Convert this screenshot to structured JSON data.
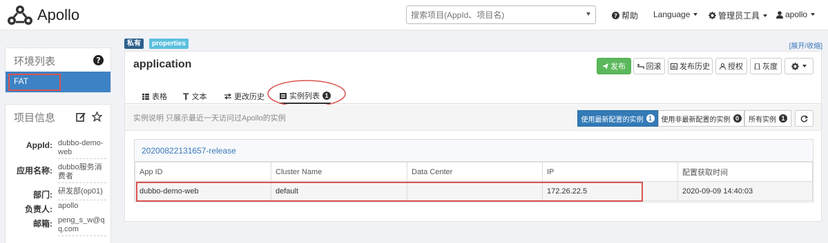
{
  "brand": {
    "name": "Apollo"
  },
  "navbar": {
    "search_placeholder": "搜索项目(AppId、项目名)",
    "help": "帮助",
    "language": "Language",
    "admin_tools": "管理员工具",
    "user": "apollo"
  },
  "sidebar": {
    "env_title": "环境列表",
    "envs": [
      "FAT"
    ],
    "project_title": "项目信息",
    "info": [
      {
        "key": "AppId:",
        "value": "dubbo-demo-web"
      },
      {
        "key": "应用名称:",
        "value": "dubbo服务消费者"
      },
      {
        "key": "部门:",
        "value": "研发部(op01)"
      },
      {
        "key": "负责人:",
        "value": "apollo"
      },
      {
        "key": "邮箱:",
        "value": "peng_s_w@qq.com"
      }
    ]
  },
  "namespace": {
    "badge_private": "私有",
    "badge_format": "properties",
    "expand_collapse": "[展开/收缩]",
    "title": "application",
    "buttons": {
      "publish": "发布",
      "rollback": "回滚",
      "history": "发布历史",
      "authorize": "授权",
      "gray": "灰度"
    },
    "tabs": [
      {
        "label": "表格"
      },
      {
        "label": "文本"
      },
      {
        "label": "更改历史"
      },
      {
        "label": "实例列表",
        "count": "1"
      }
    ],
    "instance_note": "实例说明 只展示最近一天访问过Apollo的实例",
    "filters": [
      {
        "label": "使用最新配置的实例",
        "count": "1"
      },
      {
        "label": "使用非最新配置的实例",
        "count": "0"
      },
      {
        "label": "所有实例",
        "count": "1"
      }
    ],
    "release_name": "20200822131657-release",
    "table": {
      "headers": [
        "App ID",
        "Cluster Name",
        "Data Center",
        "IP",
        "配置获取时间"
      ],
      "rows": [
        [
          "dubbo-demo-web",
          "default",
          "",
          "172.26.22.5",
          "2020-09-09 14:40:03"
        ]
      ]
    }
  },
  "colors": {
    "primary": "#337ab7",
    "success": "#5cb85c",
    "highlight": "#d9534f"
  }
}
